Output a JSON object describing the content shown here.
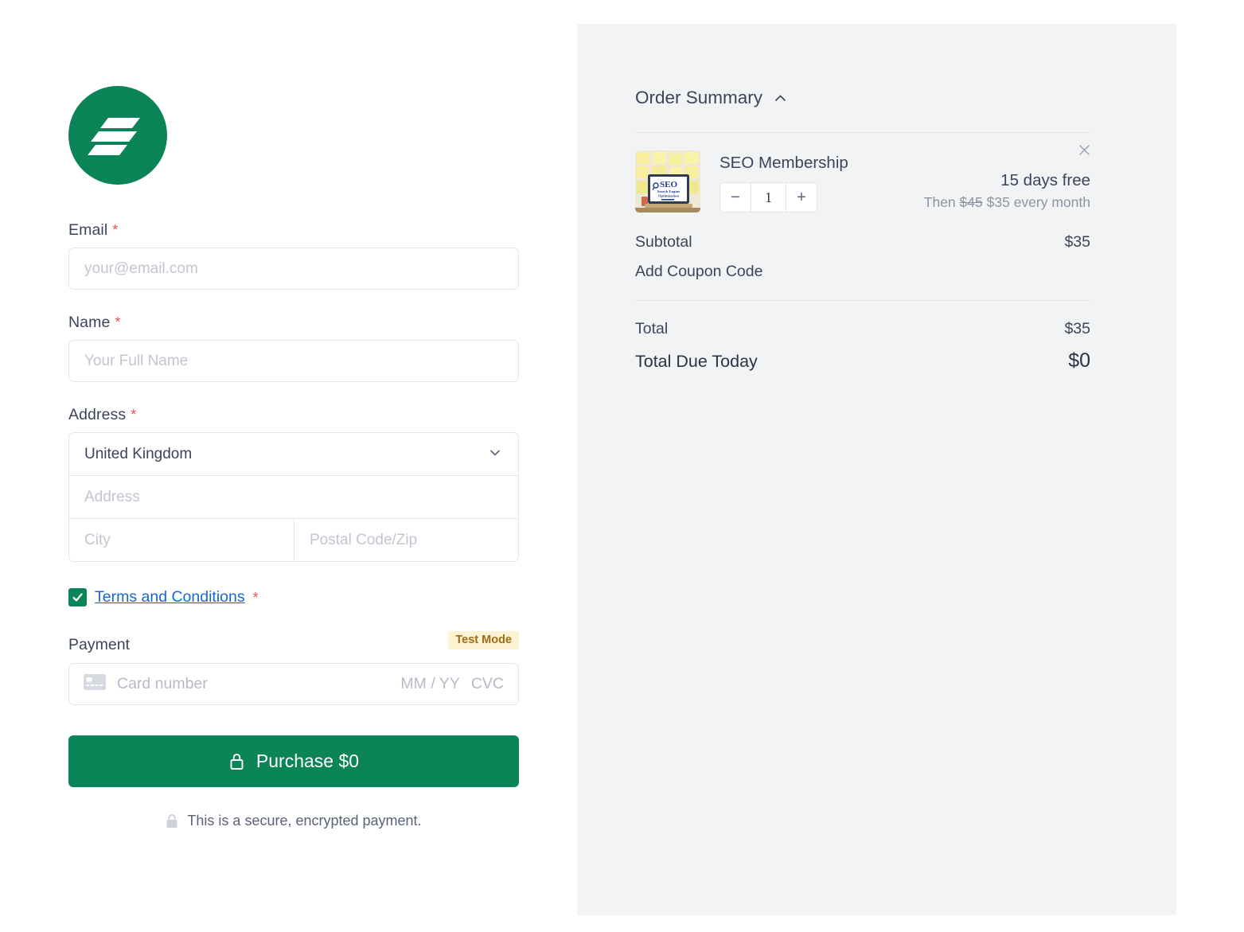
{
  "brand": {
    "logo_icon": "company-logo-s-mark",
    "logo_bg_color": "#0b8457"
  },
  "form": {
    "email": {
      "label": "Email",
      "required_marker": "*",
      "placeholder": "your@email.com",
      "value": ""
    },
    "name": {
      "label": "Name",
      "required_marker": "*",
      "placeholder": "Your Full Name",
      "value": ""
    },
    "address": {
      "label": "Address",
      "required_marker": "*",
      "country_value": "United Kingdom",
      "street_placeholder": "Address",
      "street_value": "",
      "city_placeholder": "City",
      "city_value": "",
      "postal_placeholder": "Postal Code/Zip",
      "postal_value": ""
    },
    "terms": {
      "link_label": "Terms and Conditions",
      "required_marker": "*",
      "checked": true
    },
    "payment": {
      "label": "Payment",
      "test_mode_badge": "Test Mode",
      "card_number_placeholder": "Card number",
      "card_expiry_placeholder": "MM / YY",
      "card_cvc_placeholder": "CVC"
    },
    "purchase_button": {
      "label": "Purchase $0",
      "icon": "lock-icon",
      "color": "#0b8457"
    },
    "secure_note": {
      "text": "This is a secure, encrypted payment.",
      "icon": "padlock-icon"
    }
  },
  "summary": {
    "title": "Order Summary",
    "collapse_icon": "chevron-up-icon",
    "item": {
      "name": "SEO Membership",
      "thumbnail_alt": "seo-membership-product-image",
      "quantity": "1",
      "decrement_label": "−",
      "increment_label": "+",
      "trial_text": "15 days free",
      "then_prefix": "Then",
      "original_price": "$45",
      "price": "$35",
      "billing_period": "every month",
      "remove_icon": "close-icon"
    },
    "totals": [
      {
        "label": "Subtotal",
        "value": "$35"
      }
    ],
    "coupon_label": "Add Coupon Code",
    "final_totals": [
      {
        "label": "Total",
        "value": "$35"
      }
    ],
    "due_today": {
      "label": "Total Due Today",
      "value": "$0"
    }
  }
}
